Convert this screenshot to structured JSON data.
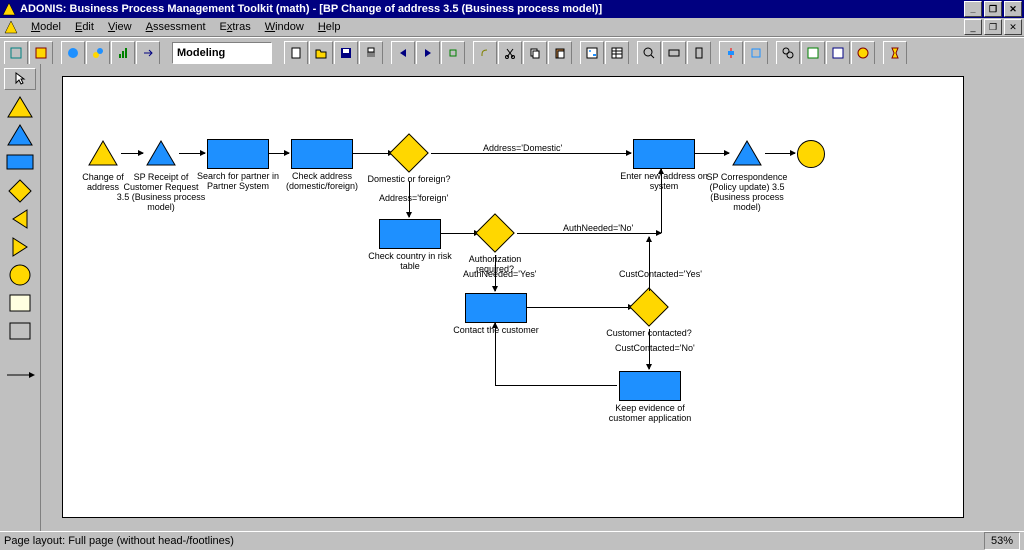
{
  "title": "ADONIS: Business Process Management Toolkit (math) - [BP Change of address 3.5 (Business process model)]",
  "menu": {
    "model": "Model",
    "edit": "Edit",
    "view": "View",
    "assessment": "Assessment",
    "extras": "Extras",
    "window": "Window",
    "help": "Help"
  },
  "mode_label": "Modeling",
  "status": {
    "layout": "Page layout: Full page (without head-/footlines)",
    "zoom": "53%"
  },
  "nodes": {
    "start": "Change of address",
    "receipt": "SP Receipt of Customer Request 3.5 (Business process model)",
    "search": "Search for partner in Partner System",
    "check": "Check address (domestic/foreign)",
    "dec1": "Domestic or foreign?",
    "enter": "Enter new address on system",
    "corr": "SP Correspondence (Policy update) 3.5 (Business process model)",
    "risk": "Check country in risk table",
    "dec2": "Authorization required?",
    "contact": "Contact the customer",
    "dec3": "Customer contacted?",
    "keep": "Keep evidence of customer application"
  },
  "edges": {
    "domestic": "Address='Domestic'",
    "foreign": "Address='foreign'",
    "authno": "AuthNeeded='No'",
    "authyes": "AuthNeeded='Yes'",
    "contyes": "CustContacted='Yes'",
    "contno": "CustContacted='No'"
  }
}
